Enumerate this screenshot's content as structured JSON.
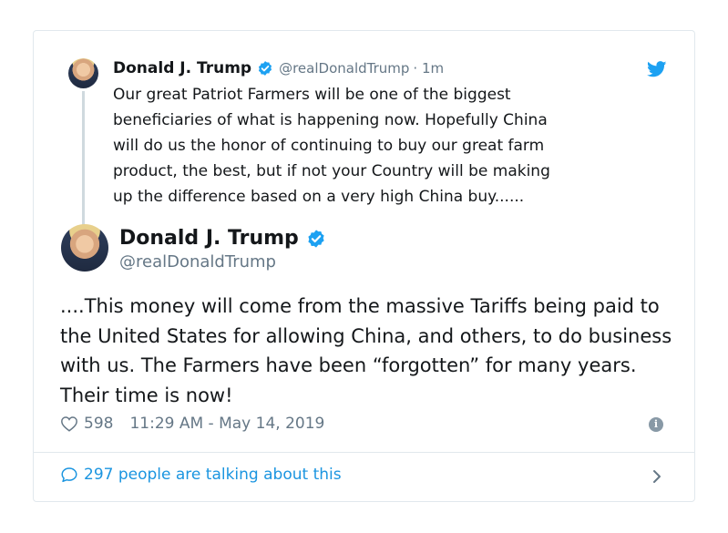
{
  "parent_tweet": {
    "name": "Donald J. Trump",
    "handle": "@realDonaldTrump",
    "time": "· 1m",
    "text": "Our great Patriot Farmers will be one of the biggest\nbeneficiaries of what is happening now. Hopefully China\nwill do us the honor of continuing to buy our great farm\nproduct, the best, but if not your Country will be making\nup the difference based on a very high China buy......"
  },
  "main_tweet": {
    "name": "Donald J. Trump",
    "handle": "@realDonaldTrump",
    "text": "....This money will come from the massive Tariffs being paid to the United States for allowing China, and others, to do business with us. The Farmers have been “forgotten” for many years. Their time is now!",
    "likes": "598",
    "timestamp": "11:29 AM - May 14, 2019"
  },
  "footer": {
    "talking_label": "297 people are talking about this"
  },
  "icons": {
    "verified": "verified-badge-icon",
    "twitter": "twitter-bird-icon",
    "like": "heart-icon",
    "info": "info-icon",
    "reply": "speech-bubble-icon",
    "chevron": "chevron-right-icon"
  },
  "colors": {
    "brand_blue": "#1da1f2",
    "link_blue": "#1b95e0",
    "muted": "#657786",
    "border": "#e1e8ed"
  }
}
